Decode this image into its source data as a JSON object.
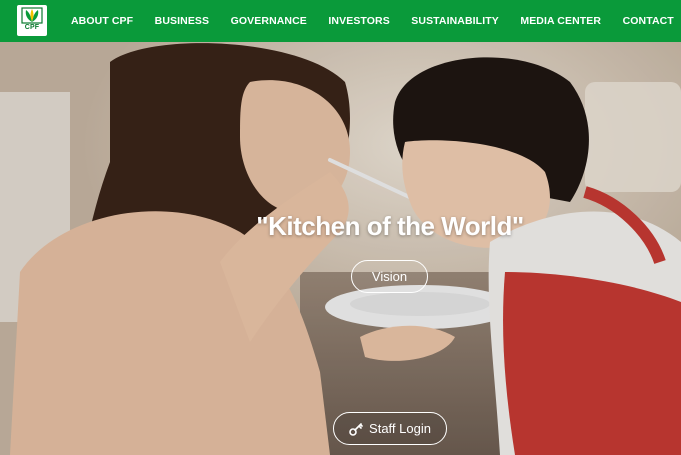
{
  "header": {
    "logo_text": "CPF",
    "nav": [
      {
        "label": "ABOUT CPF"
      },
      {
        "label": "BUSINESS"
      },
      {
        "label": "GOVERNANCE"
      },
      {
        "label": "INVESTORS"
      },
      {
        "label": "SUSTAINABILITY"
      },
      {
        "label": "MEDIA CENTER"
      },
      {
        "label": "CONTACT"
      }
    ]
  },
  "hero": {
    "title": "\"Kitchen of the World\"",
    "vision_button": "Vision",
    "staff_login_button": "Staff Login",
    "staff_login_icon": "key-icon"
  },
  "colors": {
    "header_bg": "#0a9a3a",
    "text": "#ffffff"
  }
}
